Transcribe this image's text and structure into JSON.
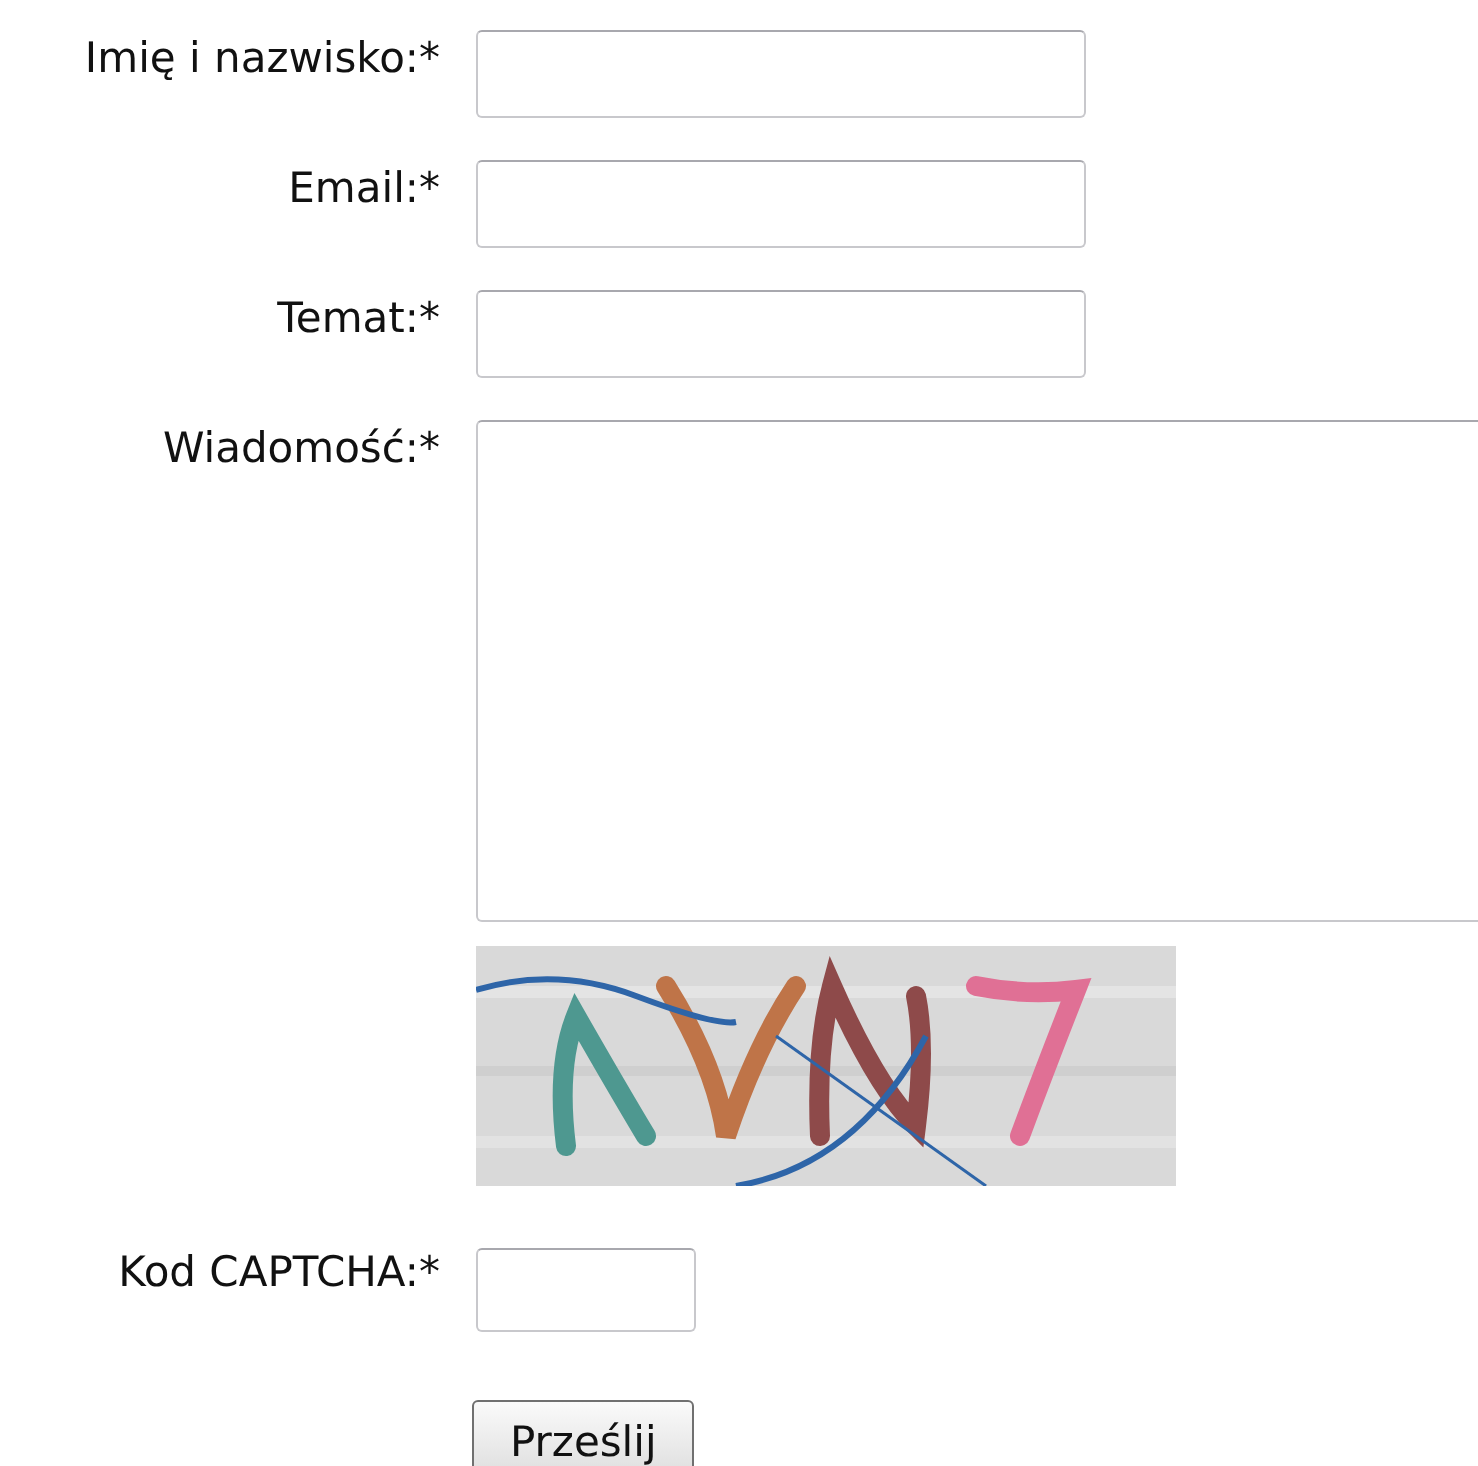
{
  "rows": [
    {
      "kind": "text",
      "label": "Imię i nazwisko:*"
    },
    {
      "kind": "text",
      "label": "Email:*"
    },
    {
      "kind": "text",
      "label": "Temat:*"
    },
    {
      "kind": "textarea",
      "label": "Wiadomość:*"
    },
    {
      "kind": "picture"
    },
    {
      "kind": "captcha",
      "label": "Kod CAPTCHA:*"
    }
  ],
  "submit_button": "Prześlij"
}
